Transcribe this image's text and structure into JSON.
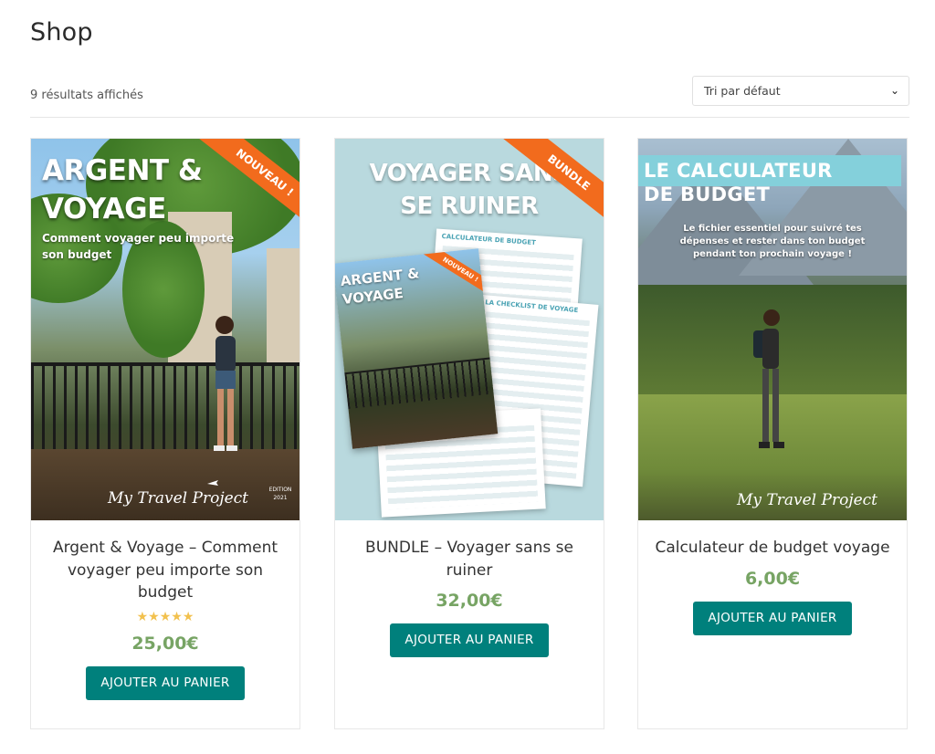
{
  "page": {
    "title": "Shop",
    "result_count": "9 résultats affichés"
  },
  "sort": {
    "selected": "Tri par défaut"
  },
  "products": [
    {
      "title": "Argent & Voyage – Comment voyager peu importe son budget",
      "rating_stars": "★★★★★",
      "rating": 5,
      "price": "25,00€",
      "button": "AJOUTER AU PANIER",
      "image": {
        "headline_1": "ARGENT &",
        "headline_2": "VOYAGE",
        "subtitle_1": "Comment voyager peu importe",
        "subtitle_2": "son budget",
        "ribbon": "NOUVEAU !",
        "signature": "My Travel Project",
        "edition": "EDITION 2021"
      }
    },
    {
      "title": "BUNDLE – Voyager sans se ruiner",
      "price": "32,00€",
      "button": "AJOUTER AU PANIER",
      "image": {
        "headline_1": "VOYAGER SANS",
        "headline_2": "SE RUINER",
        "ribbon": "BUNDLE",
        "sheet_1": "CALCULATEUR DE BUDGET",
        "sheet_2": "LA CHECKLIST DE VOYAGE",
        "mini_title_1": "ARGENT &",
        "mini_title_2": "VOYAGE",
        "mini_ribbon": "NOUVEAU !"
      }
    },
    {
      "title": "Calculateur de budget voyage",
      "price": "6,00€",
      "button": "AJOUTER AU PANIER",
      "image": {
        "headline_1": "LE CALCULATEUR",
        "headline_2": "DE BUDGET",
        "subtitle": "Le fichier essentiel pour suivré tes dépenses et rester dans ton budget pendant ton prochain voyage !",
        "signature": "My Travel Project"
      }
    }
  ],
  "colors": {
    "button": "#00807c",
    "price": "#77a464",
    "ribbon": "#f26b1d",
    "stars": "#f2c14e"
  }
}
